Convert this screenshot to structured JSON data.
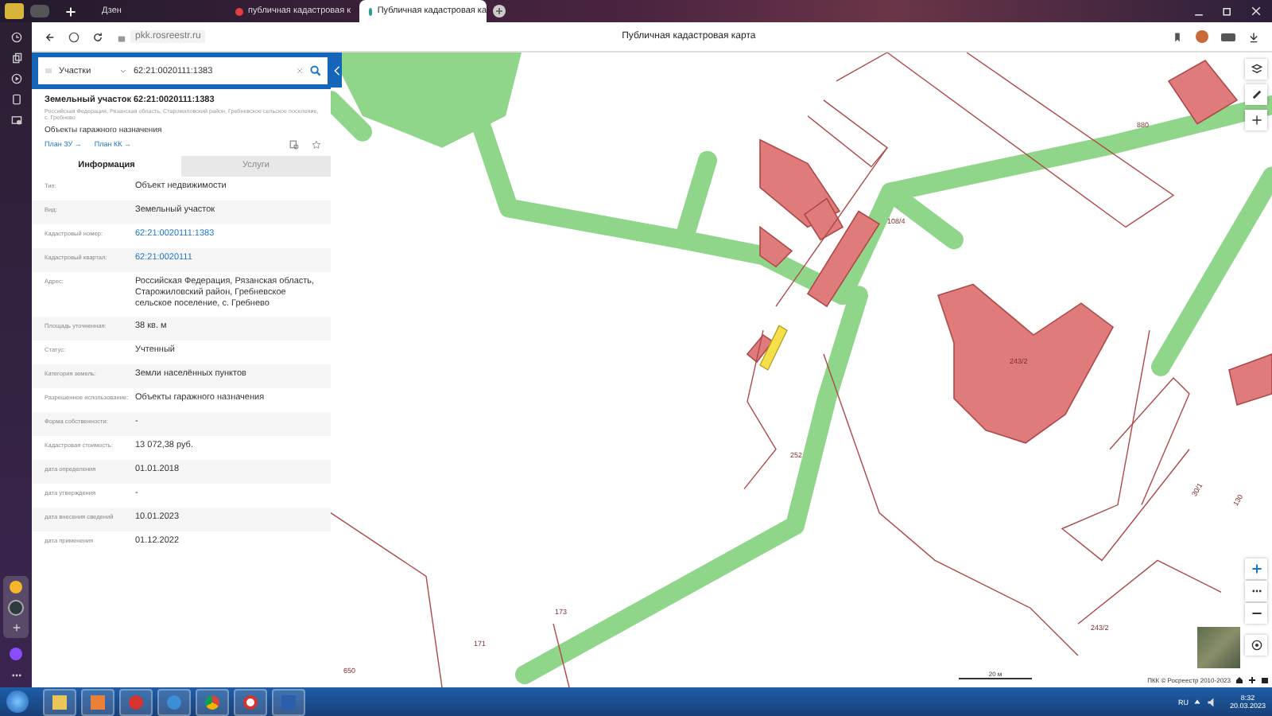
{
  "browser": {
    "tabs": [
      {
        "title": "Дзен",
        "selected": false
      },
      {
        "title": "публичная кадастровая к",
        "selected": false
      },
      {
        "title": "Публичная кадастровая ка",
        "selected": true
      }
    ],
    "url": "pkk.rosreestr.ru",
    "page_title": "Публичная кадастровая карта"
  },
  "panel": {
    "search": {
      "type": "Участки",
      "value": "62:21:0020111:1383"
    },
    "object": {
      "title": "Земельный участок 62:21:0020111:1383",
      "address": "Российская Федерация, Рязанская область, Старожиловский район, Гребневское сельское поселение, с. Гребнево",
      "purpose": "Объекты гаражного назначения",
      "links": [
        "План ЗУ →",
        "План КК →"
      ]
    },
    "tabs": [
      {
        "label": "Информация",
        "selected": true
      },
      {
        "label": "Услуги",
        "selected": false
      }
    ],
    "fields": [
      {
        "label": "Тип:",
        "value": "Объект недвижимости",
        "kind": "text"
      },
      {
        "label": "Вид:",
        "value": "Земельный участок",
        "kind": "text"
      },
      {
        "label": "Кадастровый номер:",
        "value": "62:21:0020111:1383",
        "kind": "link"
      },
      {
        "label": "Кадастровый квартал:",
        "value": "62:21:0020111",
        "kind": "link"
      },
      {
        "label": "Адрес:",
        "value": "Российская Федерация, Рязанская область, Старожиловский район, Гребневское сельское поселение, с. Гребнево",
        "kind": "text"
      },
      {
        "label": "Площадь уточненная:",
        "value": "38 кв. м",
        "kind": "text"
      },
      {
        "label": "Статус:",
        "value": "Учтенный",
        "kind": "text"
      },
      {
        "label": "Категория земель:",
        "value": "Земли населённых пунктов",
        "kind": "text"
      },
      {
        "label": "Разрешенное использование:",
        "value": "Объекты гаражного назначения",
        "kind": "text"
      },
      {
        "label": "Форма собственности:",
        "value": "-",
        "kind": "text"
      },
      {
        "label": "Кадастровая стоимость:",
        "value": "13 072,38 руб.",
        "kind": "text"
      },
      {
        "label": "дата определения",
        "value": "01.01.2018",
        "kind": "text"
      },
      {
        "label": "дата утверждения",
        "value": "-",
        "kind": "text"
      },
      {
        "label": "дата внесения сведений",
        "value": "10.01.2023",
        "kind": "text"
      },
      {
        "label": "дата применения",
        "value": "01.12.2022",
        "kind": "text"
      }
    ]
  },
  "map": {
    "labels": [
      "880",
      "108/4",
      "243/2",
      "252",
      "30/1",
      "130",
      "173",
      "171",
      "650",
      "243/2"
    ],
    "scale": "20 м",
    "attribution": "ПКК © Росреестр 2010-2023"
  },
  "taskbar": {
    "lang": "RU",
    "time": "8:32",
    "date": "20.03.2023"
  }
}
